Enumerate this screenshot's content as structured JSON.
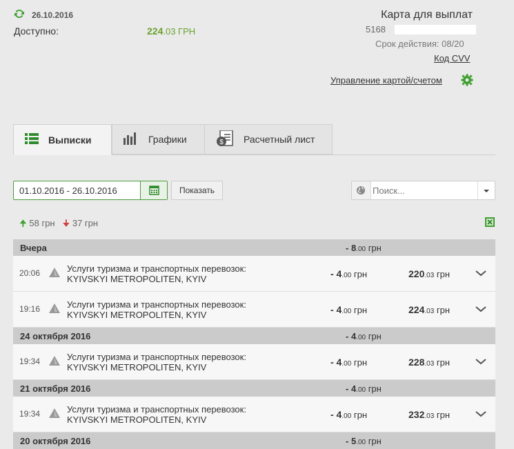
{
  "header": {
    "date": "26.10.2016",
    "available_label": "Доступно:",
    "available_int": "224",
    "available_frac": ".03",
    "available_cur": " ГРН",
    "card_title": "Карта для выплат",
    "card_number": "5168",
    "expiry": "Срок действия: 08/20",
    "cvv_link": "Код CVV",
    "manage_link": "Управление картой/счетом",
    "accent_color": "#3e9f2e"
  },
  "tabs": [
    {
      "label": "Выписки",
      "icon": "list-icon",
      "active": true
    },
    {
      "label": "Графики",
      "icon": "bar-chart-icon",
      "active": false
    },
    {
      "label": "Расчетный лист",
      "icon": "document-money-icon",
      "active": false
    }
  ],
  "filter": {
    "date_range": "01.10.2016 - 26.10.2016",
    "show_button": "Показать",
    "search_placeholder": "Поиск..."
  },
  "totals": {
    "incoming": "58 грн",
    "outgoing": "37 грн"
  },
  "groups": [
    {
      "title": "Вчера",
      "sum_int": "- 8",
      "sum_frac": ".00",
      "cur": " грн",
      "rows": [
        {
          "time": "20:06",
          "desc1": "Услуги туризма и транспортных перевозок:",
          "desc2": "KYIVSKYI METROPOLITEN, KYIV",
          "amt_int": "- 4",
          "amt_frac": ".00",
          "bal_int": "220",
          "bal_frac": ".03",
          "cur": " грн"
        },
        {
          "time": "19:16",
          "desc1": "Услуги туризма и транспортных перевозок:",
          "desc2": "KYIVSKYI METROPOLITEN, KYIV",
          "amt_int": "- 4",
          "amt_frac": ".00",
          "bal_int": "224",
          "bal_frac": ".03",
          "cur": " грн"
        }
      ]
    },
    {
      "title": "24 октября 2016",
      "sum_int": "- 4",
      "sum_frac": ".00",
      "cur": " грн",
      "rows": [
        {
          "time": "19:34",
          "desc1": "Услуги туризма и транспортных перевозок:",
          "desc2": "KYIVSKYI METROPOLITEN, KYIV",
          "amt_int": "- 4",
          "amt_frac": ".00",
          "bal_int": "228",
          "bal_frac": ".03",
          "cur": " грн"
        }
      ]
    },
    {
      "title": "21 октября 2016",
      "sum_int": "- 4",
      "sum_frac": ".00",
      "cur": " грн",
      "rows": [
        {
          "time": "19:34",
          "desc1": "Услуги туризма и транспортных перевозок:",
          "desc2": "KYIVSKYI METROPOLITEN, KYIV",
          "amt_int": "- 4",
          "amt_frac": ".00",
          "bal_int": "232",
          "bal_frac": ".03",
          "cur": " грн"
        }
      ]
    },
    {
      "title": "20 октября 2016",
      "sum_int": "- 5",
      "sum_frac": ".00",
      "cur": " грн",
      "rows": []
    }
  ]
}
